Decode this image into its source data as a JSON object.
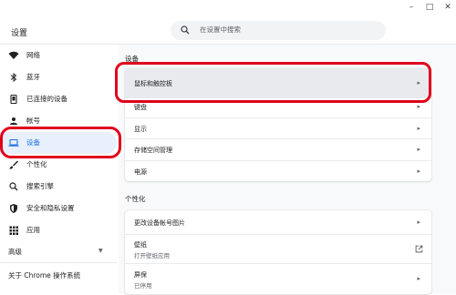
{
  "window": {
    "minimize": "–",
    "maximize": "□",
    "close": "✕"
  },
  "header": {
    "title": "设置",
    "search_placeholder": "在设置中搜索"
  },
  "sidebar": {
    "items": [
      {
        "label": "网络",
        "icon": "wifi-icon"
      },
      {
        "label": "蓝牙",
        "icon": "bluetooth-icon"
      },
      {
        "label": "已连接的设备",
        "icon": "connected-devices-icon"
      },
      {
        "label": "帐号",
        "icon": "account-icon"
      },
      {
        "label": "设备",
        "icon": "laptop-icon"
      },
      {
        "label": "个性化",
        "icon": "brush-icon"
      },
      {
        "label": "搜索引擎",
        "icon": "search-icon"
      },
      {
        "label": "安全和隐私设置",
        "icon": "shield-icon"
      },
      {
        "label": "应用",
        "icon": "apps-grid-icon"
      }
    ],
    "advanced": "高级",
    "about": "关于 Chrome 操作系统"
  },
  "device_section": {
    "title": "设备",
    "rows": [
      {
        "title": "鼠标和触控板"
      },
      {
        "title": "键盘"
      },
      {
        "title": "显示"
      },
      {
        "title": "存储空间管理"
      },
      {
        "title": "电源"
      }
    ]
  },
  "personalization_section": {
    "title": "个性化",
    "rows": [
      {
        "title": "更改设备帐号图片"
      },
      {
        "title": "壁纸",
        "subtitle": "打开壁纸应用"
      },
      {
        "title": "屏保",
        "subtitle": "已停用"
      }
    ]
  },
  "colors": {
    "accent": "#1a73e8",
    "annotation": "#e0001b",
    "active_bg": "#e8f0fe"
  }
}
